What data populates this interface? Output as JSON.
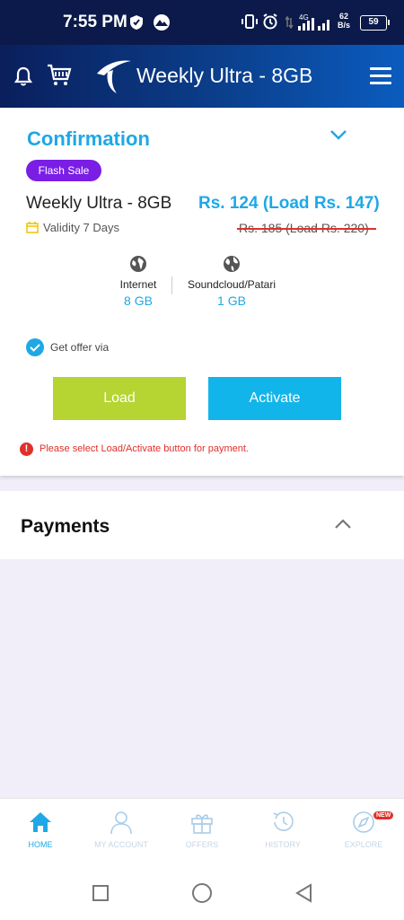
{
  "status_bar": {
    "time": "7:55 PM",
    "network": "4G",
    "speed_value": "62",
    "speed_unit": "B/s",
    "battery": "59",
    "icons": [
      "shield-icon",
      "mountain-icon",
      "vibrate-icon",
      "alarm-icon",
      "signal-icon"
    ]
  },
  "header": {
    "title": "Weekly Ultra - 8GB",
    "icons": [
      "bell-icon",
      "cart-icon",
      "telenor-logo-icon",
      "menu-icon"
    ]
  },
  "confirmation": {
    "title": "Confirmation",
    "badge": "Flash Sale",
    "package_name": "Weekly Ultra - 8GB",
    "price": "Rs. 124 (Load Rs. 147)",
    "validity": "Validity 7 Days",
    "old_price": "Rs. 185 (Load Rs. 220)",
    "resources": [
      {
        "label": "Internet",
        "value": "8 GB",
        "icon": "globe-icon"
      },
      {
        "label": "Soundcloud/Patari",
        "value": "1 GB",
        "icon": "globe-icon"
      }
    ],
    "offer_via_label": "Get offer via",
    "offer_via_checked": true,
    "load_button": "Load",
    "activate_button": "Activate",
    "warning": "Please select Load/Activate button for payment."
  },
  "payments": {
    "title": "Payments"
  },
  "bottom_nav": {
    "items": [
      {
        "label": "HOME",
        "icon": "home-icon",
        "active": true
      },
      {
        "label": "MY ACCOUNT",
        "icon": "user-icon",
        "active": false
      },
      {
        "label": "OFFERS",
        "icon": "gift-icon",
        "active": false
      },
      {
        "label": "HISTORY",
        "icon": "history-icon",
        "active": false
      },
      {
        "label": "EXPLORE",
        "icon": "explore-icon",
        "active": false,
        "badge": "NEW"
      }
    ]
  },
  "colors": {
    "accent": "#1ea8e6",
    "header_dark": "#0a1f5c",
    "flash_sale": "#7a1ee6",
    "load_button": "#b6d432",
    "activate_button": "#12b5ea",
    "warning": "#e0302a"
  }
}
